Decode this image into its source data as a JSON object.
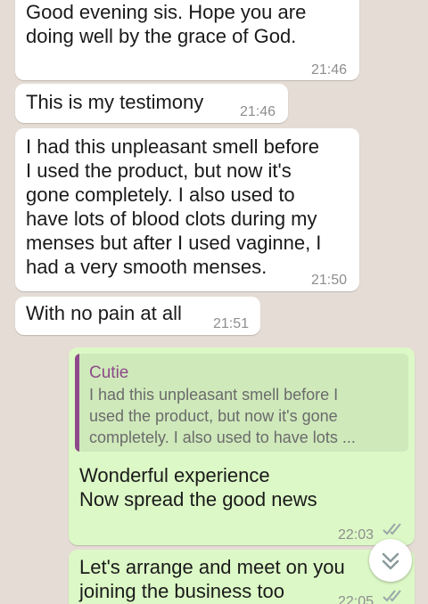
{
  "messages": [
    {
      "type": "incoming",
      "text": "Good evening sis. Hope you are\ndoing well by the grace of God.",
      "time": "21:46"
    },
    {
      "type": "incoming",
      "text": "This is my testimony",
      "time": "21:46"
    },
    {
      "type": "incoming",
      "text": "I had this unpleasant smell before\nI used the product, but now it's\ngone completely. I also used to\nhave lots of blood clots during my\nmenses but after I used vaginne, I\nhad a very smooth menses.",
      "time": "21:50"
    },
    {
      "type": "incoming",
      "text": "With no pain at all",
      "time": "21:51"
    },
    {
      "type": "outgoing",
      "quote": {
        "author": "Cutie",
        "text": "I had this unpleasant smell before I\nused the product, but now it's gone\ncompletely. I also used to have lots ..."
      },
      "text": "Wonderful experience\nNow spread the good news",
      "time": "22:03",
      "status": "read"
    },
    {
      "type": "outgoing",
      "text": "Let's arrange and meet on you\njoining the business too",
      "time": "22:05",
      "status": "read"
    }
  ],
  "colors": {
    "background": "#e5ddd5",
    "incoming": "#ffffff",
    "outgoing": "#dcf8c6",
    "quote_accent": "#8e4a8a",
    "read_ticks": "#9aa6a8"
  },
  "icons": {
    "read_receipt": "double-check-icon",
    "scroll_down": "double-chevron-down-icon"
  }
}
